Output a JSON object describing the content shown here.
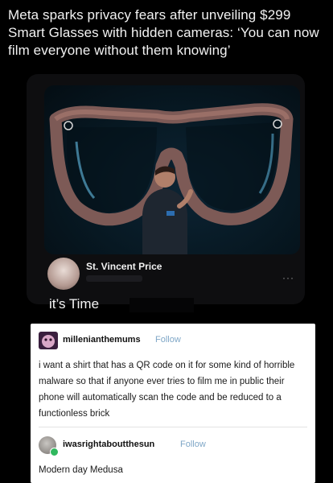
{
  "headline": "Meta sparks privacy fears after unveiling $299 Smart Glasses with hidden cameras: ‘You can now film everyone without them knowing’",
  "tweet": {
    "author_name": "St. Vincent Price",
    "text": "it’s Time",
    "more_icon": "more-dots-icon"
  },
  "tumblr_post": {
    "username": "millenianthemums",
    "follow_label": "Follow",
    "body": "i want a shirt that has a QR code on it for some kind of horrible malware so that if anyone ever tries to film me in public their phone will automatically scan the code and be reduced to a functionless brick",
    "reply": {
      "username": "iwasrightaboutthesun",
      "follow_label": "Follow",
      "body": "Modern day Medusa"
    },
    "colors": {
      "follow": "#7fa7c7",
      "badge": "#30b85e"
    }
  }
}
